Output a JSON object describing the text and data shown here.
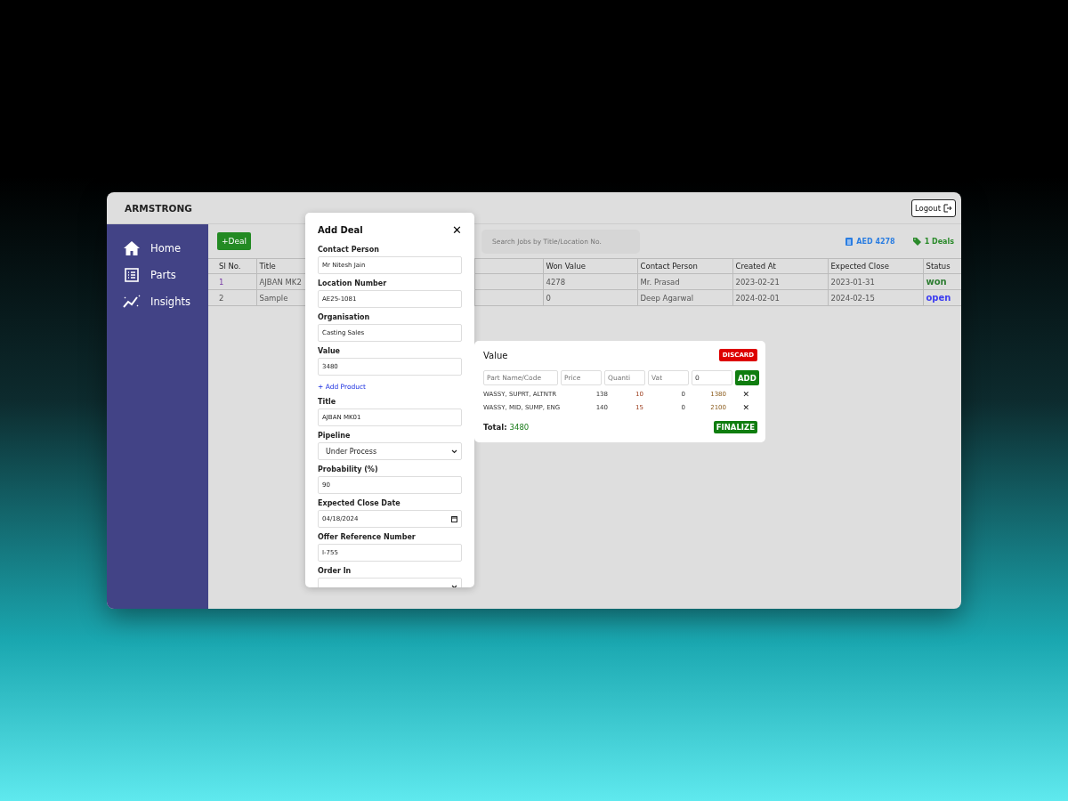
{
  "app": {
    "brand": "ARMSTRONG",
    "logout": "Logout"
  },
  "sidebar": {
    "items": [
      {
        "label": "Home",
        "kind": "home"
      },
      {
        "label": "Parts",
        "kind": "list"
      },
      {
        "label": "Insights",
        "kind": "chart"
      }
    ]
  },
  "toolbar": {
    "add_button": "+Deal",
    "search": {
      "placeholder": "Search Jobs by Title/Location No."
    },
    "total_value": "AED 4278",
    "deal_count": "1 Deals"
  },
  "table": {
    "columns": [
      "Sl No.",
      "Title",
      "",
      "Won Value",
      "Contact Person",
      "Created At",
      "Expected Close",
      "Status"
    ],
    "rows": [
      {
        "cells": [
          "1",
          "AJBAN MK2",
          "",
          "4278",
          "Mr. Prasad",
          "2023-02-21",
          "2023-01-31",
          "won"
        ],
        "color": "#2e7d32"
      },
      {
        "cells": [
          "2",
          "Sample",
          "",
          "0",
          "Deep Agarwal",
          "2024-02-01",
          "2024-02-15",
          "open"
        ],
        "color": "#3d3df0"
      }
    ]
  },
  "add_deal": {
    "title": "Add Deal",
    "close": "✕",
    "fields": [
      {
        "label": "Contact Person",
        "kind": "text",
        "value": "Mr Nitesh Jain"
      },
      {
        "label": "Location Number",
        "kind": "text",
        "value": "AE25-1081"
      },
      {
        "label": "Organisation",
        "kind": "text",
        "value": "Casting Sales"
      },
      {
        "label": "Value",
        "kind": "text",
        "value": "3480",
        "link": "+ Add Product"
      },
      {
        "label": "Title",
        "kind": "text",
        "value": "AJBAN MK01"
      },
      {
        "label": "Pipeline",
        "kind": "select",
        "value": "Under Process"
      },
      {
        "label": "Probability (%)",
        "kind": "text",
        "value": "90"
      },
      {
        "label": "Expected Close Date",
        "kind": "date",
        "value": "04/18/2024"
      },
      {
        "label": "Offer Reference Number",
        "kind": "text",
        "value": "I-755"
      },
      {
        "label": "Order In",
        "kind": "select"
      }
    ]
  },
  "value_popup": {
    "title": "Value",
    "discard": "DISCARD",
    "inputs": [
      {
        "placeholder": "Part Name/Code"
      },
      {
        "placeholder": "Price"
      },
      {
        "placeholder": "Quanti"
      },
      {
        "placeholder": "Vat"
      },
      {
        "value": "0"
      }
    ],
    "add": "ADD",
    "items": [
      {
        "name": "WASSY, SUPRT, ALTNTR",
        "price": "138",
        "quantity": "10",
        "vat": "0",
        "total": "1380",
        "remove": "✕"
      },
      {
        "name": "WASSY, MID, SUMP, ENG",
        "price": "140",
        "quantity": "15",
        "vat": "0",
        "total": "2100",
        "remove": "✕"
      }
    ],
    "total_label": "Total:",
    "total": "3480",
    "finalize": "FINALIZE"
  }
}
